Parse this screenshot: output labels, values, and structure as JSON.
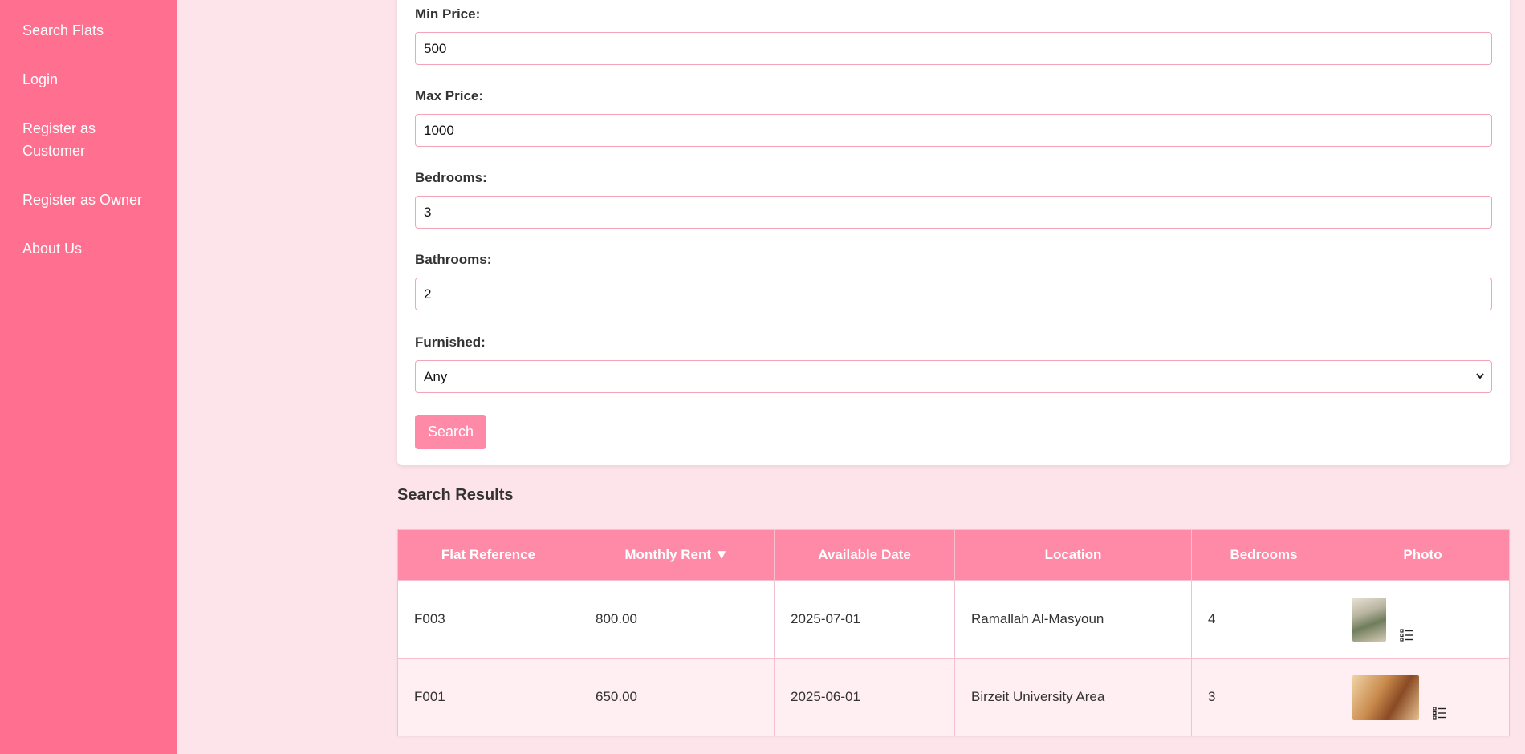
{
  "sidebar": {
    "items": [
      {
        "label": "Search Flats"
      },
      {
        "label": "Login"
      },
      {
        "label": "Register as Customer"
      },
      {
        "label": "Register as Owner"
      },
      {
        "label": "About Us"
      }
    ]
  },
  "search_form": {
    "min_price": {
      "label": "Min Price:",
      "value": "500"
    },
    "max_price": {
      "label": "Max Price:",
      "value": "1000"
    },
    "bedrooms": {
      "label": "Bedrooms:",
      "value": "3"
    },
    "bathrooms": {
      "label": "Bathrooms:",
      "value": "2"
    },
    "furnished": {
      "label": "Furnished:",
      "value": "Any"
    },
    "search_label": "Search"
  },
  "results": {
    "title": "Search Results",
    "headers": [
      "Flat Reference",
      "Monthly Rent ▼",
      "Available Date",
      "Location",
      "Bedrooms",
      "Photo"
    ],
    "rows": [
      {
        "ref": "F003",
        "rent": "800.00",
        "date": "2025-07-01",
        "location": "Ramallah Al-Masyoun",
        "bedrooms": "4",
        "photo_icon": "plant-photo"
      },
      {
        "ref": "F001",
        "rent": "650.00",
        "date": "2025-06-01",
        "location": "Birzeit University Area",
        "bedrooms": "3",
        "photo_icon": "room-photo"
      }
    ]
  },
  "colors": {
    "sidebar": "#ff7090",
    "page_bg": "#fde4ea",
    "header_bg": "#ff8aa8",
    "border": "#f4a3b8"
  }
}
